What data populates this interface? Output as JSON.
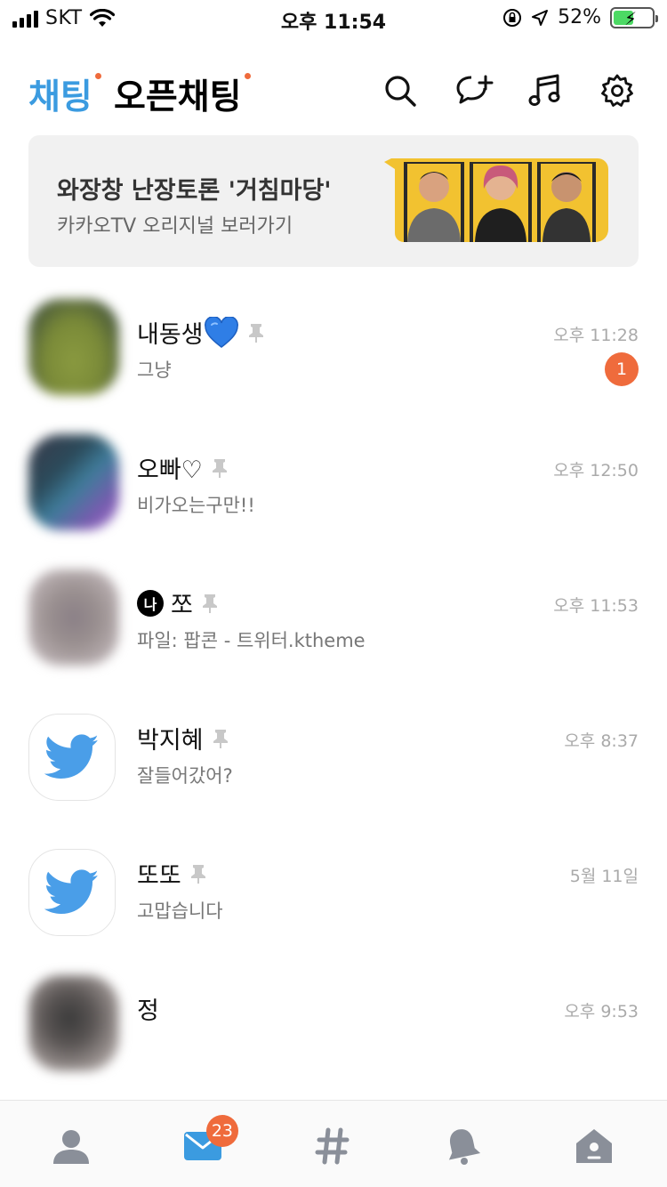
{
  "status_bar": {
    "carrier": "SKT",
    "time": "오후 11:54",
    "battery": "52%",
    "battery_level": 0.52
  },
  "header": {
    "tab_chat": "채팅",
    "tab_open_chat": "오픈채팅",
    "icons": [
      "search-icon",
      "new-chat-icon",
      "music-icon",
      "settings-icon"
    ]
  },
  "banner": {
    "title": "와장창 난장토론 '거침마당'",
    "subtitle": "카카오TV 오리지널 보러가기"
  },
  "chats": [
    {
      "name": "내동생",
      "preview": "그냥",
      "time": "오후 11:28",
      "unread": "1"
    },
    {
      "name": "오빠♡",
      "preview": "비가오는구만!!",
      "time": "오후 12:50"
    },
    {
      "me_badge": "나",
      "name": "쪼",
      "preview": "파일: 팝콘 - 트위터.ktheme",
      "time": "오후 11:53"
    },
    {
      "name": "박지혜",
      "preview": "잘들어갔어?",
      "time": "오후 8:37"
    },
    {
      "name": "또또",
      "preview": "고맙습니다",
      "time": "5월 11일"
    },
    {
      "name": "정",
      "preview": "",
      "time": "오후 9:53"
    }
  ],
  "bottom_nav": {
    "chat_badge": "23"
  },
  "colors": {
    "accent_blue": "#3b9be0",
    "badge_orange": "#ef6b3c",
    "twitter_blue": "#4a9ee8",
    "nav_icon_gray": "#8a8f99"
  }
}
